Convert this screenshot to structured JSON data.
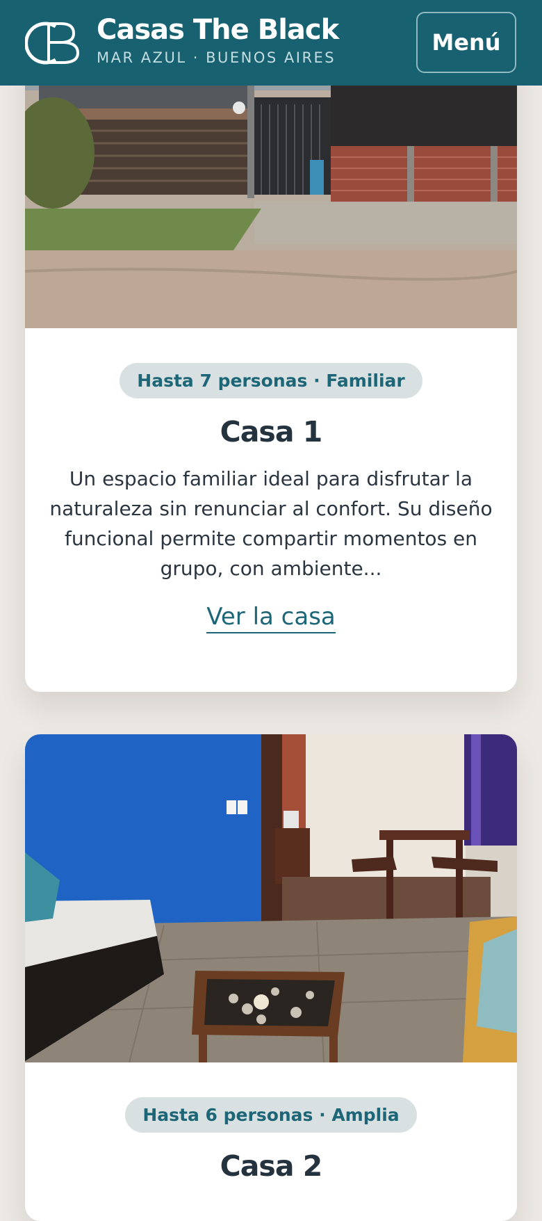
{
  "header": {
    "brand_name": "Casas The Black",
    "brand_subtitle": "MAR AZUL · BUENOS AIRES",
    "menu_label": "Menú"
  },
  "houses": [
    {
      "badge": "Hasta 7 personas · Familiar",
      "title": "Casa 1",
      "description": "Un espacio familiar ideal para disfrutar la naturaleza sin renunciar al confort. Su diseño funcional permite compartir momentos en grupo, con ambiente...",
      "link_label": "Ver la casa"
    },
    {
      "badge": "Hasta 6 personas · Amplia",
      "title": "Casa 2"
    }
  ],
  "colors": {
    "header_bg": "#176170",
    "accent": "#1d6677",
    "page_bg": "#ece8e4",
    "badge_bg": "#d8e0e2"
  }
}
